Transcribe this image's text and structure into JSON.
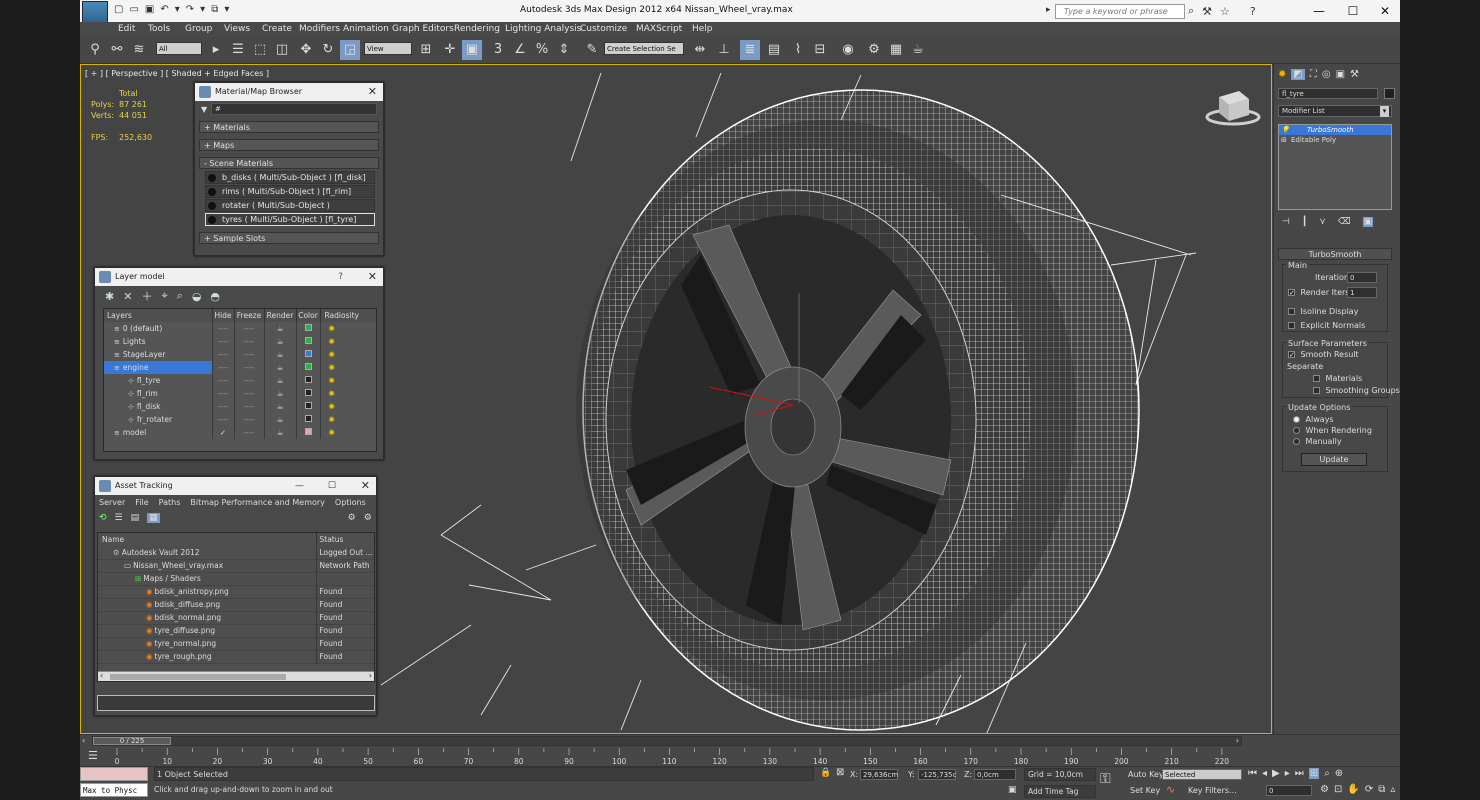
{
  "app": {
    "title": "Autodesk 3ds Max Design 2012 x64       Nissan_Wheel_vray.max",
    "search_placeholder": "Type a keyword or phrase"
  },
  "menu": [
    "Edit",
    "Tools",
    "Group",
    "Views",
    "Create",
    "Modifiers",
    "Animation",
    "Graph Editors",
    "Rendering",
    "Lighting Analysis",
    "Customize",
    "MAXScript",
    "Help"
  ],
  "toolbar": {
    "selection_filter": "All",
    "ref_coord": "View",
    "named_selection": "Create Selection Se"
  },
  "viewport": {
    "label": "[ + ] [ Perspective ] [ Shaded + Edged Faces ]",
    "stats": {
      "total_label": "Total",
      "polys_label": "Polys:",
      "polys": "87 261",
      "verts_label": "Verts:",
      "verts": "44 051",
      "fps_label": "FPS:",
      "fps": "252,630"
    }
  },
  "material_browser": {
    "title": "Material/Map Browser",
    "search": "#",
    "sections": [
      "+ Materials",
      "+ Maps",
      "- Scene Materials"
    ],
    "materials": [
      "b_disks  ( Multi/Sub-Object ) [fl_disk]",
      "rims  ( Multi/Sub-Object ) [fl_rim]",
      "rotater  ( Multi/Sub-Object ) [fr_rotater]",
      "tyres  ( Multi/Sub-Object ) [fl_tyre]"
    ],
    "footer_section": "+ Sample Slots"
  },
  "layer_manager": {
    "title": "Layer model",
    "help": "?",
    "columns": [
      "Layers",
      "Hide",
      "Freeze",
      "Render",
      "Color",
      "Radiosity"
    ],
    "rows": [
      {
        "name": "0 (default)",
        "indent": 0,
        "color": "#2ab04a",
        "active": false,
        "check": false
      },
      {
        "name": "Lights",
        "indent": 0,
        "color": "#2ab04a",
        "active": false,
        "check": false
      },
      {
        "name": "StageLayer",
        "indent": 0,
        "color": "#3a7ad8",
        "active": false,
        "check": false
      },
      {
        "name": "engine",
        "indent": 0,
        "color": "#2ab04a",
        "active": true,
        "check": false
      },
      {
        "name": "fl_tyre",
        "indent": 1,
        "color": "#222222",
        "active": false,
        "check": false
      },
      {
        "name": "fl_rim",
        "indent": 1,
        "color": "#222222",
        "active": false,
        "check": false
      },
      {
        "name": "fl_disk",
        "indent": 1,
        "color": "#222222",
        "active": false,
        "check": false
      },
      {
        "name": "fr_rotater",
        "indent": 1,
        "color": "#222222",
        "active": false,
        "check": false
      },
      {
        "name": "model",
        "indent": 0,
        "color": "#e9a0b0",
        "active": false,
        "check": true
      }
    ],
    "checkmark": "✓",
    "hide_placeholder": "----"
  },
  "asset_tracking": {
    "title": "Asset Tracking",
    "menu": [
      "Server",
      "File",
      "Paths",
      "Bitmap Performance and Memory",
      "Options"
    ],
    "columns": [
      "Name",
      "Status"
    ],
    "rows": [
      {
        "name": "Autodesk Vault 2012",
        "status": "Logged Out ...",
        "indent": 1
      },
      {
        "name": "Nissan_Wheel_vray.max",
        "status": "Network Path",
        "indent": 2
      },
      {
        "name": "Maps / Shaders",
        "status": "",
        "indent": 3
      },
      {
        "name": "bdisk_anistropy.png",
        "status": "Found",
        "indent": 4
      },
      {
        "name": "bdisk_diffuse.png",
        "status": "Found",
        "indent": 4
      },
      {
        "name": "bdisk_normal.png",
        "status": "Found",
        "indent": 4
      },
      {
        "name": "tyre_diffuse.png",
        "status": "Found",
        "indent": 4
      },
      {
        "name": "tyre_normal.png",
        "status": "Found",
        "indent": 4
      },
      {
        "name": "tyre_rough.png",
        "status": "Found",
        "indent": 4
      }
    ]
  },
  "command_panel": {
    "object_name": "fl_tyre",
    "modifier_list": "Modifier List",
    "stack": [
      "TurboSmooth",
      "Editable Poly"
    ],
    "turbosmooth": {
      "title": "TurboSmooth",
      "main": "Main",
      "iterations_label": "Iterations:",
      "iterations": "0",
      "render_iters_label": "Render Iters:",
      "render_iters": "1",
      "isoline": "Isoline Display",
      "explicit_normals": "Explicit Normals",
      "surface_params": "Surface Parameters",
      "smooth_result": "Smooth Result",
      "separate": "Separate",
      "materials": "Materials",
      "smoothing_groups": "Smoothing Groups",
      "update_options": "Update Options",
      "always": "Always",
      "when_rendering": "When Rendering",
      "manually": "Manually",
      "update_button": "Update"
    }
  },
  "timeline": {
    "frame": "0 / 225",
    "ticks": [
      "0",
      "10",
      "20",
      "30",
      "40",
      "50",
      "60",
      "70",
      "80",
      "90",
      "100",
      "110",
      "120",
      "130",
      "140",
      "150",
      "160",
      "170",
      "180",
      "190",
      "200",
      "210",
      "220"
    ]
  },
  "status": {
    "maxscript": "Max to Physc",
    "selected": "1 Object Selected",
    "prompt": "Click and drag up-and-down to zoom in and out",
    "x_label": "X:",
    "x": "29,636cm",
    "y_label": "Y:",
    "y": "-125,735c",
    "z_label": "Z:",
    "z": "0,0cm",
    "grid": "Grid = 10,0cm",
    "add_time_tag": "Add Time Tag",
    "auto_key": "Auto Key",
    "auto_key_value": "Selected",
    "set_key": "Set Key",
    "key_filters": "Key Filters...",
    "current_frame": "0"
  }
}
